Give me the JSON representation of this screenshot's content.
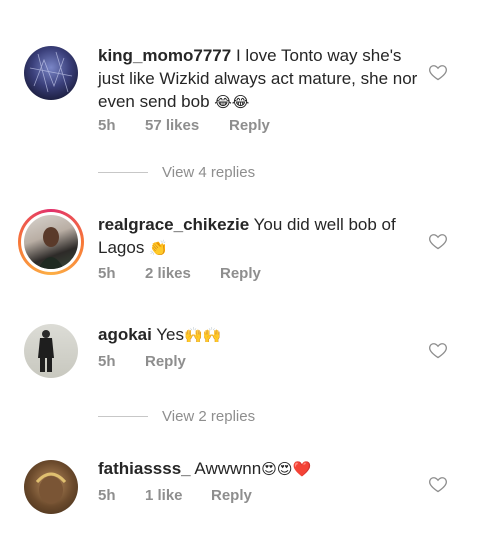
{
  "comments": [
    {
      "username": "king_momo7777",
      "text": "I love Tonto way she's just like Wizkid always act mature, she nor even send bob",
      "emoji": "😂😂",
      "time": "5h",
      "likes": "57 likes",
      "reply_label": "Reply",
      "view_replies": "View 4 replies"
    },
    {
      "username": "realgrace_chikezie",
      "text": "You did well bob of Lagos",
      "emoji": "👏",
      "time": "5h",
      "likes": "2 likes",
      "reply_label": "Reply"
    },
    {
      "username": "agokai",
      "text": "Yes",
      "emoji": "🙌🙌",
      "time": "5h",
      "reply_label": "Reply",
      "view_replies": "View 2 replies"
    },
    {
      "username": "fathiassss_",
      "text": "Awwwnn",
      "emoji": "😍😍❤️",
      "time": "5h",
      "likes": "1 like",
      "reply_label": "Reply"
    }
  ],
  "colors": {
    "text": "#262626",
    "meta": "#8e8e8e",
    "story_ring": "#e1306c"
  },
  "icons": [
    "heart-outline-icon"
  ]
}
